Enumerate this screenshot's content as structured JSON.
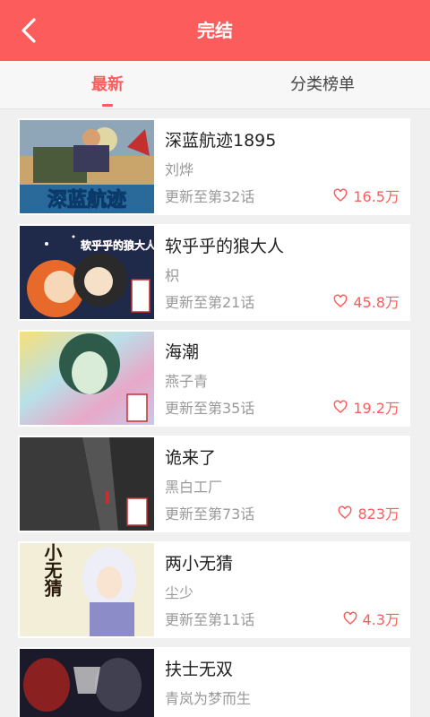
{
  "header": {
    "title": "完结",
    "back_icon": "chevron-left-icon"
  },
  "tabs": [
    {
      "label": "最新",
      "active": true
    },
    {
      "label": "分类榜单",
      "active": false
    }
  ],
  "colors": {
    "accent": "#fc5c5b",
    "background": "#f0f0f0"
  },
  "comics": [
    {
      "title": "深蓝航迹1895",
      "author": "刘烨",
      "update": "更新至第32话",
      "likes": "16.5万",
      "cover_text": "深蓝航迹"
    },
    {
      "title": "软乎乎的狼大人",
      "author": "枳",
      "update": "更新至第21话",
      "likes": "45.8万",
      "cover_text": "软乎乎的狼大人"
    },
    {
      "title": "海潮",
      "author": "燕子青",
      "update": "更新至第35话",
      "likes": "19.2万",
      "cover_text": ""
    },
    {
      "title": "诡来了",
      "author": "黑白工厂",
      "update": "更新至第73话",
      "likes": "823万",
      "cover_text": ""
    },
    {
      "title": "两小无猜",
      "author": "尘少",
      "update": "更新至第11话",
      "likes": "4.3万",
      "cover_text": "两小无猜"
    },
    {
      "title": "扶士无双",
      "author": "青岚为梦而生",
      "update": "",
      "likes": "",
      "cover_text": ""
    }
  ]
}
